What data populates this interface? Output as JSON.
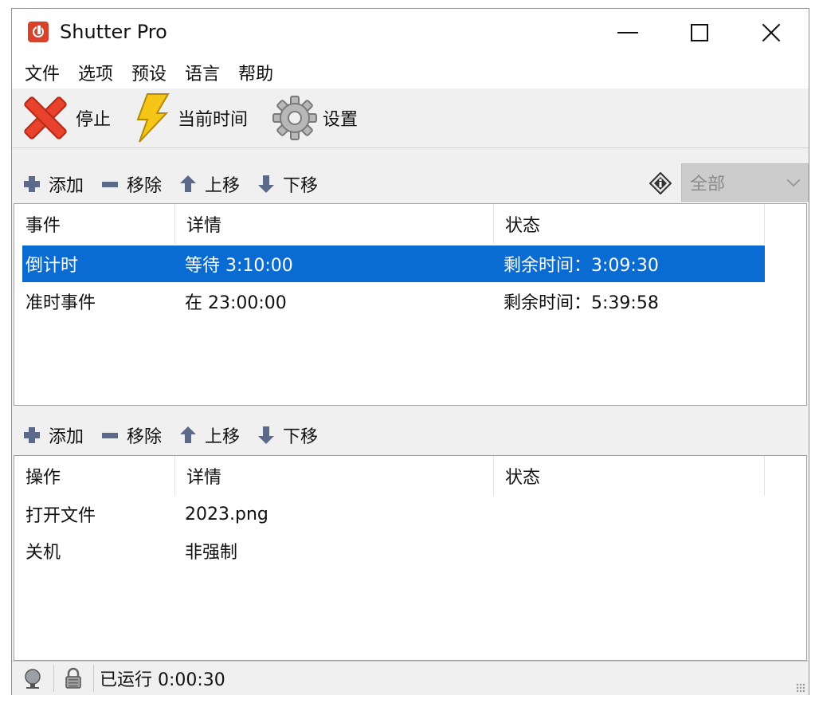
{
  "window": {
    "title": "Shutter Pro"
  },
  "menu": {
    "items": [
      "文件",
      "选项",
      "预设",
      "语言",
      "帮助"
    ]
  },
  "toolbar": {
    "stop_label": "停止",
    "time_label": "当前时间",
    "settings_label": "设置"
  },
  "events_panel": {
    "add_label": "添加",
    "remove_label": "移除",
    "up_label": "上移",
    "down_label": "下移",
    "filter_value": "全部",
    "columns": [
      "事件",
      "详情",
      "状态"
    ],
    "rows": [
      {
        "event": "倒计时",
        "detail": "等待 3:10:00",
        "status": "剩余时间：3:09:30",
        "selected": true
      },
      {
        "event": "准时事件",
        "detail": "在 23:00:00",
        "status": "剩余时间：5:39:58",
        "selected": false
      }
    ]
  },
  "actions_panel": {
    "add_label": "添加",
    "remove_label": "移除",
    "up_label": "上移",
    "down_label": "下移",
    "columns": [
      "操作",
      "详情",
      "状态"
    ],
    "rows": [
      {
        "action": "打开文件",
        "detail": "2023.png",
        "status": ""
      },
      {
        "action": "关机",
        "detail": "非强制",
        "status": ""
      }
    ]
  },
  "statusbar": {
    "running_text": "已运行 0:00:30"
  },
  "colors": {
    "selection": "#0a6cd3",
    "stop_red": "#e8412c",
    "bolt_yellow": "#f5c518",
    "app_icon": "#d9412b"
  }
}
